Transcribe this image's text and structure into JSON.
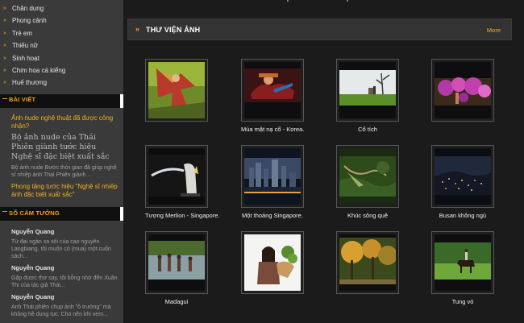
{
  "sidebar": {
    "categories": [
      "Chân dung",
      "Phong cảnh",
      "Trẻ em",
      "Thiếu nữ",
      "Sinh hoạt",
      "Chim hoa cá kiểng",
      "Huế thương"
    ],
    "posts_header": "BÀI VIẾT",
    "post": {
      "link": "Ảnh nude nghệ thuật đã được công nhận?",
      "title": "Bộ ảnh nude của Thái Phiên giành tước hiệu Nghệ sĩ đặc biệt xuất sắc",
      "desc": "Bộ ảnh nude Bước thời gian đã giúp nghệ sĩ nhiếp ảnh Thái Phiên giành...",
      "link2": "Phong tặng tước hiệu \"Nghệ sĩ nhiếp ảnh đặc biệt xuất sắc\""
    },
    "comments_header": "SỔ CẢM TƯỞNG",
    "comments": [
      {
        "name": "Nguyễn Quang",
        "text": "Từ đại ngàn xa xôi của cao nguyên Langbiang, tôi muốn có (mua) một cuốn sách..."
      },
      {
        "name": "Nguyễn Quang",
        "text": "Gặp được thơ say, tôi bỗng nhớ đến Xuân Thi của tác giả Thái..."
      },
      {
        "name": "Nguyễn Quang",
        "text": "Anh Thái phiên chụp ảnh \"ô trường\" mà không hề dung tục. Cho nên khi xem..."
      }
    ]
  },
  "gallery": {
    "title": "THƯ VIỆN ẢNH",
    "more": "More",
    "items": [
      {
        "caption": "",
        "icon": "dancer-photo"
      },
      {
        "caption": "Múa mặt nạ cổ - Korea.",
        "icon": "mask-dance-photo"
      },
      {
        "caption": "Cổ tích",
        "icon": "fairy-tale-photo"
      },
      {
        "caption": "",
        "icon": "flowers-photo"
      },
      {
        "caption": "Tượng Merlion - Singapore.",
        "icon": "merlion-photo"
      },
      {
        "caption": "Một thoáng Singapore.",
        "icon": "singapore-skyline-photo"
      },
      {
        "caption": "Khúc sông quê",
        "icon": "river-photo"
      },
      {
        "caption": "Busan không ngủ",
        "icon": "busan-night-photo"
      },
      {
        "caption": "Madagui",
        "icon": "madagui-photo"
      },
      {
        "caption": "",
        "icon": "girl-flowers-photo"
      },
      {
        "caption": "",
        "icon": "autumn-trees-photo"
      },
      {
        "caption": "Tung vó",
        "icon": "horse-rider-photo"
      }
    ]
  },
  "colors": {
    "accent": "#f2a21a",
    "sidebar": "#3a3a3a",
    "background": "#1b1b1b"
  }
}
